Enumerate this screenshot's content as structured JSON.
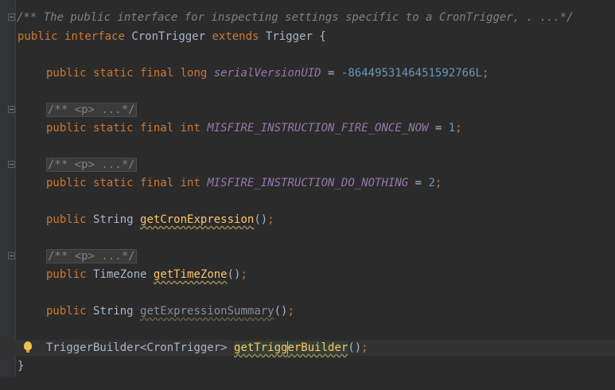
{
  "code": {
    "header_comment": "/** The public interface for inspecting settings specific to a CronTrigger, . ...*/",
    "decl_public": "public",
    "decl_interface": "interface",
    "decl_name": "CronTrigger",
    "decl_extends": "extends",
    "decl_parent": "Trigger",
    "decl_brace": "{",
    "modifiers": "public static final",
    "type_long": "long",
    "type_int": "int",
    "serial_name": "serialVersionUID",
    "serial_value": "-8644953146451592766L",
    "folded_doc": "/** <p> ...*/",
    "fire_once_name": "MISFIRE_INSTRUCTION_FIRE_ONCE_NOW",
    "fire_once_value": "1",
    "do_nothing_name": "MISFIRE_INSTRUCTION_DO_NOTHING",
    "do_nothing_value": "2",
    "public_kw": "public",
    "string_type": "String",
    "timezone_type": "TimeZone",
    "builder_type": "TriggerBuilder<CronTrigger>",
    "get_cron_expression": "getCronExpression",
    "get_time_zone": "getTimeZone",
    "get_expression_summary": "getExpressionSummary",
    "get_trigger_builder_a": "getTrigg",
    "get_trigger_builder_b": "erBuilder",
    "parens": "()",
    "semicolon": ";",
    "equals": "=",
    "closing_brace": "}"
  }
}
